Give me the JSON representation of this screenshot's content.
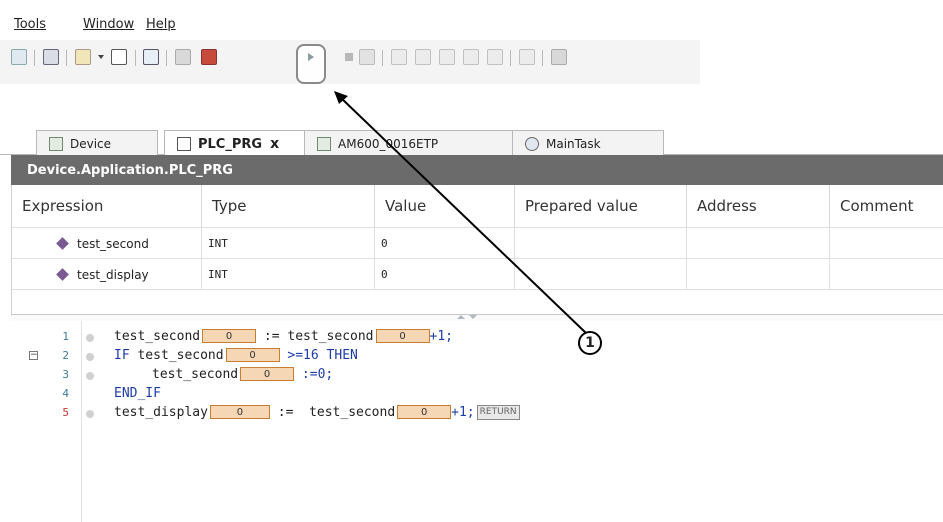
{
  "menu": {
    "items": [
      "Tools",
      "Window",
      "Help"
    ]
  },
  "tabs": [
    {
      "label": "Device",
      "active": false,
      "icon": "device-icon"
    },
    {
      "label": "PLC_PRG",
      "active": true,
      "icon": "document-icon",
      "close": "x"
    },
    {
      "label": "AM600_0016ETP",
      "active": false,
      "icon": "device-icon"
    },
    {
      "label": "MainTask",
      "active": false,
      "icon": "task-icon"
    }
  ],
  "title_bar": "Device.Application.PLC_PRG",
  "table": {
    "columns": [
      "Expression",
      "Type",
      "Value",
      "Prepared value",
      "Address",
      "Comment"
    ],
    "rows": [
      {
        "expression": "test_second",
        "type": "INT",
        "value": "0"
      },
      {
        "expression": "test_display",
        "type": "INT",
        "value": "0"
      }
    ]
  },
  "code": {
    "line_numbers": [
      "1",
      "2",
      "3",
      "4",
      "5"
    ],
    "line1": {
      "v1": "test_second",
      "iv1": "0",
      "op": " := ",
      "v2": "test_second",
      "iv2": "0",
      "tail": "+1;"
    },
    "line2": {
      "kw1": "IF",
      "v1": "test_second",
      "iv1": "0",
      "tail": " >=16 ",
      "kw2": "THEN"
    },
    "line3": {
      "v1": "test_second",
      "iv1": "0",
      "tail": " :=0;"
    },
    "line4": {
      "kw1": "END_IF"
    },
    "line5": {
      "v1": "test_display",
      "iv1": "0",
      "op": " :=  ",
      "v2": "test_second",
      "iv2": "0",
      "tail": "+1;",
      "ret": "RETURN"
    }
  },
  "fold_glyph": "−",
  "callout": {
    "number": "1"
  },
  "colors": {
    "title_bar": "#6b6b6b",
    "inline_value_bg": "#f5d7b5",
    "keyword": "#1e3ca8"
  }
}
